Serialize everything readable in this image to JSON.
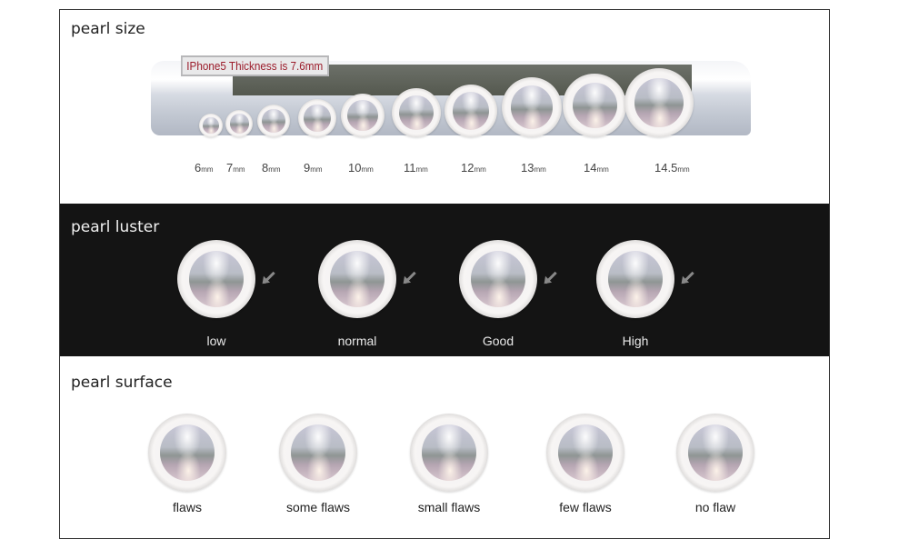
{
  "sections": {
    "size": {
      "title": "pearl size",
      "phone_label": "IPhone5 Thickness is 7.6mm",
      "pearls": [
        {
          "value": "6",
          "unit": "mm"
        },
        {
          "value": "7",
          "unit": "mm"
        },
        {
          "value": "8",
          "unit": "mm"
        },
        {
          "value": "9",
          "unit": "mm"
        },
        {
          "value": "10",
          "unit": "mm"
        },
        {
          "value": "11",
          "unit": "mm"
        },
        {
          "value": "12",
          "unit": "mm"
        },
        {
          "value": "13",
          "unit": "mm"
        },
        {
          "value": "14",
          "unit": "mm"
        },
        {
          "value": "14.5",
          "unit": "mm"
        }
      ]
    },
    "luster": {
      "title": "pearl  luster",
      "items": [
        "low",
        "normal",
        "Good",
        "High"
      ]
    },
    "surface": {
      "title": "pearl surface",
      "items": [
        "flaws",
        "some flaws",
        "small flaws",
        "few flaws",
        "no flaw"
      ]
    }
  },
  "colors": {
    "luster_bg": "#141414",
    "label_text": "#9b1b2a"
  }
}
